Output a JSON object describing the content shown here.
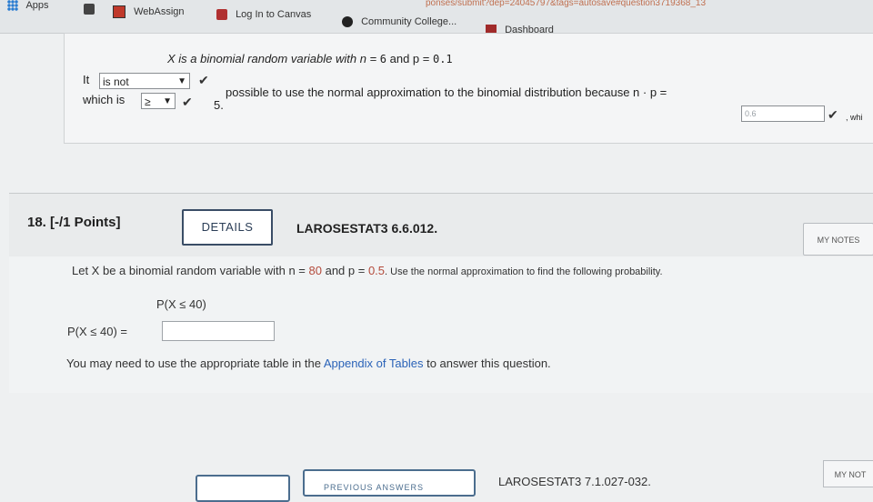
{
  "browser": {
    "url_fragment": "ponses/submit?dep=24045797&tags=autosave#question3719368_13",
    "bookmarks": [
      {
        "label": "Apps",
        "icon": "apps-grid-icon"
      },
      {
        "label": "WebAssign",
        "icon": "webassign-icon"
      },
      {
        "label": "Log In to Canvas",
        "icon": "canvas-icon"
      },
      {
        "label": "Community College...",
        "icon": "community-college-icon"
      },
      {
        "label": "Dashboard",
        "icon": "dashboard-icon"
      }
    ]
  },
  "q17": {
    "stem_prefix": "X is a binomial random variable with n = ",
    "n": "6",
    "and_p": " and p = ",
    "p": "0.1",
    "it_label": "It",
    "select_value": "is not",
    "possible_text": "possible to use the normal approximation to the binomial distribution because n · p =",
    "np_value": "0.6",
    "which_is": "which is",
    "compare_select": "≥",
    "five": "5.",
    "trailing": ", whi"
  },
  "q18": {
    "number": "18.  [-/1 Points]",
    "details_button": "DETAILS",
    "code": "LAROSESTAT3 6.6.012.",
    "my_notes": "MY NOTES",
    "prompt_a": "Let X be a binomial random variable with n = ",
    "n": "80",
    "prompt_b": " and p = ",
    "p": "0.5",
    "prompt_c": ". Use the normal approximation to find the following probability.",
    "expression": "P(X ≤ 40)",
    "answer_label": "P(X ≤ 40) =",
    "answer_value": "",
    "hint_a": "You may need to use the appropriate table in the ",
    "hint_link": "Appendix of Tables",
    "hint_b": " to answer this question."
  },
  "footer": {
    "prev_answers": "PREVIOUS ANSWERS",
    "next_code": "LAROSESTAT3 7.1.027-032.",
    "my_notes": "MY NOT"
  },
  "colors": {
    "accent": "#3a4d66",
    "number": "#b44b3c",
    "link": "#2b63b8"
  }
}
